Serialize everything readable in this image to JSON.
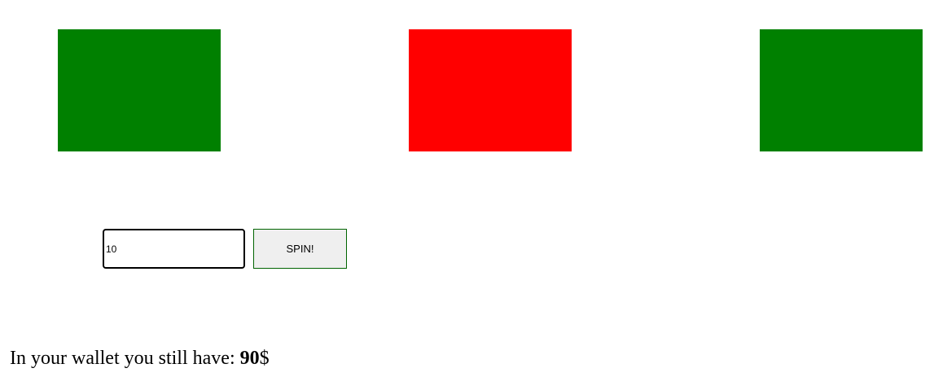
{
  "reels": [
    {
      "name": "reel-1",
      "color": "#008000"
    },
    {
      "name": "reel-2",
      "color": "#ff0000"
    },
    {
      "name": "reel-3",
      "color": "#008000"
    }
  ],
  "controls": {
    "bet_value": "10",
    "spin_label": "SPIN!"
  },
  "wallet": {
    "prefix": "In your wallet you still have: ",
    "amount": "90",
    "currency": "$"
  }
}
